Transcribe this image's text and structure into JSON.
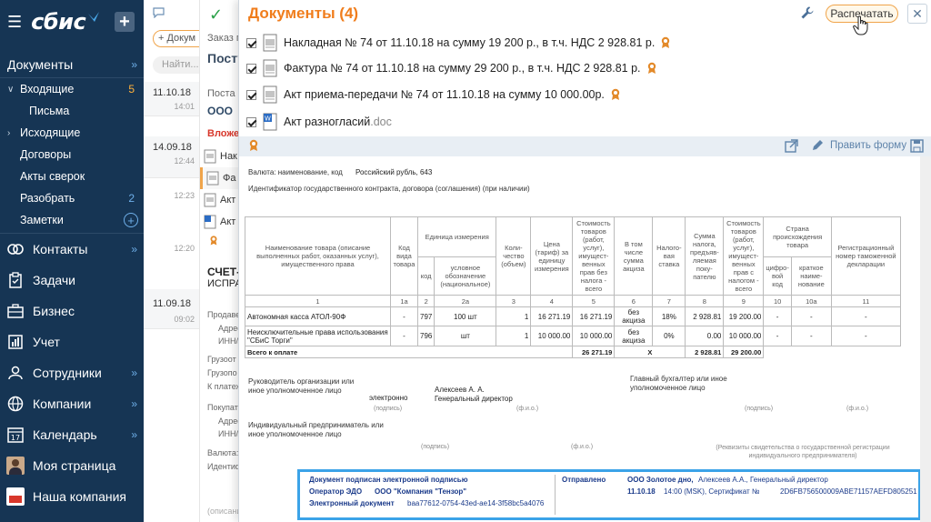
{
  "sidebar": {
    "logo": "сбис",
    "documents_label": "Документы",
    "items": [
      {
        "label": "Входящие",
        "count": "5"
      },
      {
        "label": "Письма",
        "count": ""
      },
      {
        "label": "Исходящие",
        "count": ""
      },
      {
        "label": "Договоры",
        "count": ""
      },
      {
        "label": "Акты сверок",
        "count": ""
      },
      {
        "label": "Разобрать",
        "count": "2"
      },
      {
        "label": "Заметки",
        "count": ""
      }
    ],
    "sections": [
      {
        "label": "Контакты",
        "icon": "contacts-icon"
      },
      {
        "label": "Задачи",
        "icon": "tasks-icon"
      },
      {
        "label": "Бизнес",
        "icon": "business-icon"
      },
      {
        "label": "Учет",
        "icon": "accounting-icon"
      },
      {
        "label": "Сотрудники",
        "icon": "employees-icon"
      },
      {
        "label": "Компании",
        "icon": "companies-icon"
      },
      {
        "label": "Календарь",
        "icon": "calendar-icon",
        "badge": "17"
      },
      {
        "label": "Моя страница",
        "icon": "avatar"
      },
      {
        "label": "Наша компания",
        "icon": "company-logo"
      }
    ]
  },
  "list": {
    "new_button": "+ Докум",
    "search_placeholder": "Найти...",
    "rows": [
      {
        "date": "11.10.18",
        "time": "14:01"
      },
      {
        "date": "14.09.18",
        "time": "12:44"
      },
      {
        "date": "",
        "time": "12:23"
      },
      {
        "date": "",
        "time": "12:20"
      },
      {
        "date": "11.09.18",
        "time": "09:02"
      }
    ]
  },
  "card": {
    "order": "Заказ п",
    "title": "Посту",
    "posted": "Поста",
    "ooo": "ООО",
    "attachments": "Вложен",
    "files": [
      "Нак",
      "Фа",
      "Акт",
      "Акт"
    ],
    "act_code": "СЧЕТ-Ф",
    "status": "ИСПРАВ",
    "fields": [
      "Продавец",
      "Адрес",
      "ИНН/",
      "Грузоот",
      "Грузопо",
      "К платеж",
      "Покупате",
      "Адрес",
      "ИНН/",
      "Валюта:",
      "Идентиф"
    ],
    "footer_hint": "(описани"
  },
  "dialog": {
    "title": "Документы (4)",
    "print_button": "Распечатать",
    "close_label": "✕",
    "edit_form": "Править форму",
    "documents": [
      {
        "label": "Накладная № 74 от 11.10.18 на сумму 19 200 р., в т.ч. НДС 2 928.81 р.",
        "ext": "",
        "signed": true
      },
      {
        "label": "Фактура № 74 от 11.10.18 на сумму 29 200 р., в т.ч. НДС 2 928.81 р.",
        "ext": "",
        "signed": true
      },
      {
        "label": "Акт приема-передачи № 74 от 11.10.18 на сумму 10 000.00р.",
        "ext": "",
        "signed": true
      },
      {
        "label": "Акт разногласий",
        "ext": ".doc",
        "signed": false
      }
    ]
  },
  "preview": {
    "currency_label": "Валюта: наименование, код",
    "currency_value": "Российский рубль, 643",
    "contract_id": "Идентификатор государственного контракта, договора (соглашения) (при наличии)",
    "headers": {
      "name": "Наименование товара (описание выполненных работ, оказанных услуг), имущественного права",
      "kind_code": "Код вида товара",
      "unit": "Единица измерения",
      "unit_code": "код",
      "unit_name": "условное обозначение (национальное)",
      "qty": "Коли-чество (объем)",
      "price": "Цена (тариф) за единицу измерения",
      "cost_no_tax": "Стоимость товаров (работ, услуг), имущест-венных прав без налога - всего",
      "excise": "В том числе сумма акциза",
      "tax_rate": "Налого-вая ставка",
      "tax_sum": "Сумма налога, предъяв-ляемая поку-пателю",
      "cost_with_tax": "Стоимость товаров (работ, услуг), имущест-венных прав с налогом - всего",
      "country": "Страна происхождения товара",
      "country_code": "цифро-вой код",
      "country_name": "краткое наиме-нование",
      "customs": "Регистрационный номер таможенной декларации"
    },
    "colnums": [
      "1",
      "1а",
      "2",
      "2а",
      "3",
      "4",
      "5",
      "6",
      "7",
      "8",
      "9",
      "10",
      "10а",
      "11"
    ],
    "rows": [
      {
        "name": "Автономная касса АТОЛ-90Ф",
        "kind": "-",
        "code": "797",
        "unit": "100 шт",
        "qty": "1",
        "price": "16 271.19",
        "cost": "16 271.19",
        "excise": "без акциза",
        "rate": "18%",
        "tax": "2 928.81",
        "total": "19 200.00",
        "cc": "-",
        "cn": "-",
        "customs": "-"
      },
      {
        "name": "Неисключительные права использования \"СБиС Торги\"",
        "kind": "-",
        "code": "796",
        "unit": "шт",
        "qty": "1",
        "price": "10 000.00",
        "cost": "10 000.00",
        "excise": "без акциза",
        "rate": "0%",
        "tax": "0.00",
        "total": "10 000.00",
        "cc": "-",
        "cn": "-",
        "customs": "-"
      }
    ],
    "total_row": {
      "label": "Всего к оплате",
      "cost": "26 271.19",
      "excise": "X",
      "tax": "2 928.81",
      "total": "29 200.00"
    },
    "sign": {
      "head_label": "Руководитель организации или иное уполномоченное лицо",
      "head_method": "электронно",
      "head_name": "Алексеев А. А. Генеральный директор",
      "sig_caption": "(подпись)",
      "fio_caption": "(ф.и.о.)",
      "accountant_label": "Главный бухгалтер или иное уполномоченное лицо",
      "ip_label": "Индивидуальный предприниматель или иное уполномоченное лицо",
      "ip_reg": "(Реквизиты свидетельства о государственной регистрации индивидуального предпринимателя)"
    },
    "stamp": {
      "signed_text": "Документ подписан электронной подписью",
      "operator_label": "Оператор ЭДО",
      "operator_value": "ООО \"Компания \"Тензор\"",
      "doc_label": "Электронный документ",
      "doc_id": "baa77612-0754-43ed-ae14-3f58bc5a4076",
      "sent_label": "Отправлено",
      "sent_org": "ООО Золотое дно,",
      "sent_person": "Алексеев А.А., Генеральный директор",
      "sent_date": "11.10.18",
      "sent_time": "14:00 (MSK), Сертификат №",
      "cert": "2D6FB756500009ABE71157AEFD805251"
    }
  },
  "colors": {
    "sidebar_bg": "#163554",
    "accent_orange": "#f07d1c",
    "link_blue": "#5e83aa",
    "stamp_border": "#3ba3e8",
    "seal_orange": "#e38a2a"
  }
}
